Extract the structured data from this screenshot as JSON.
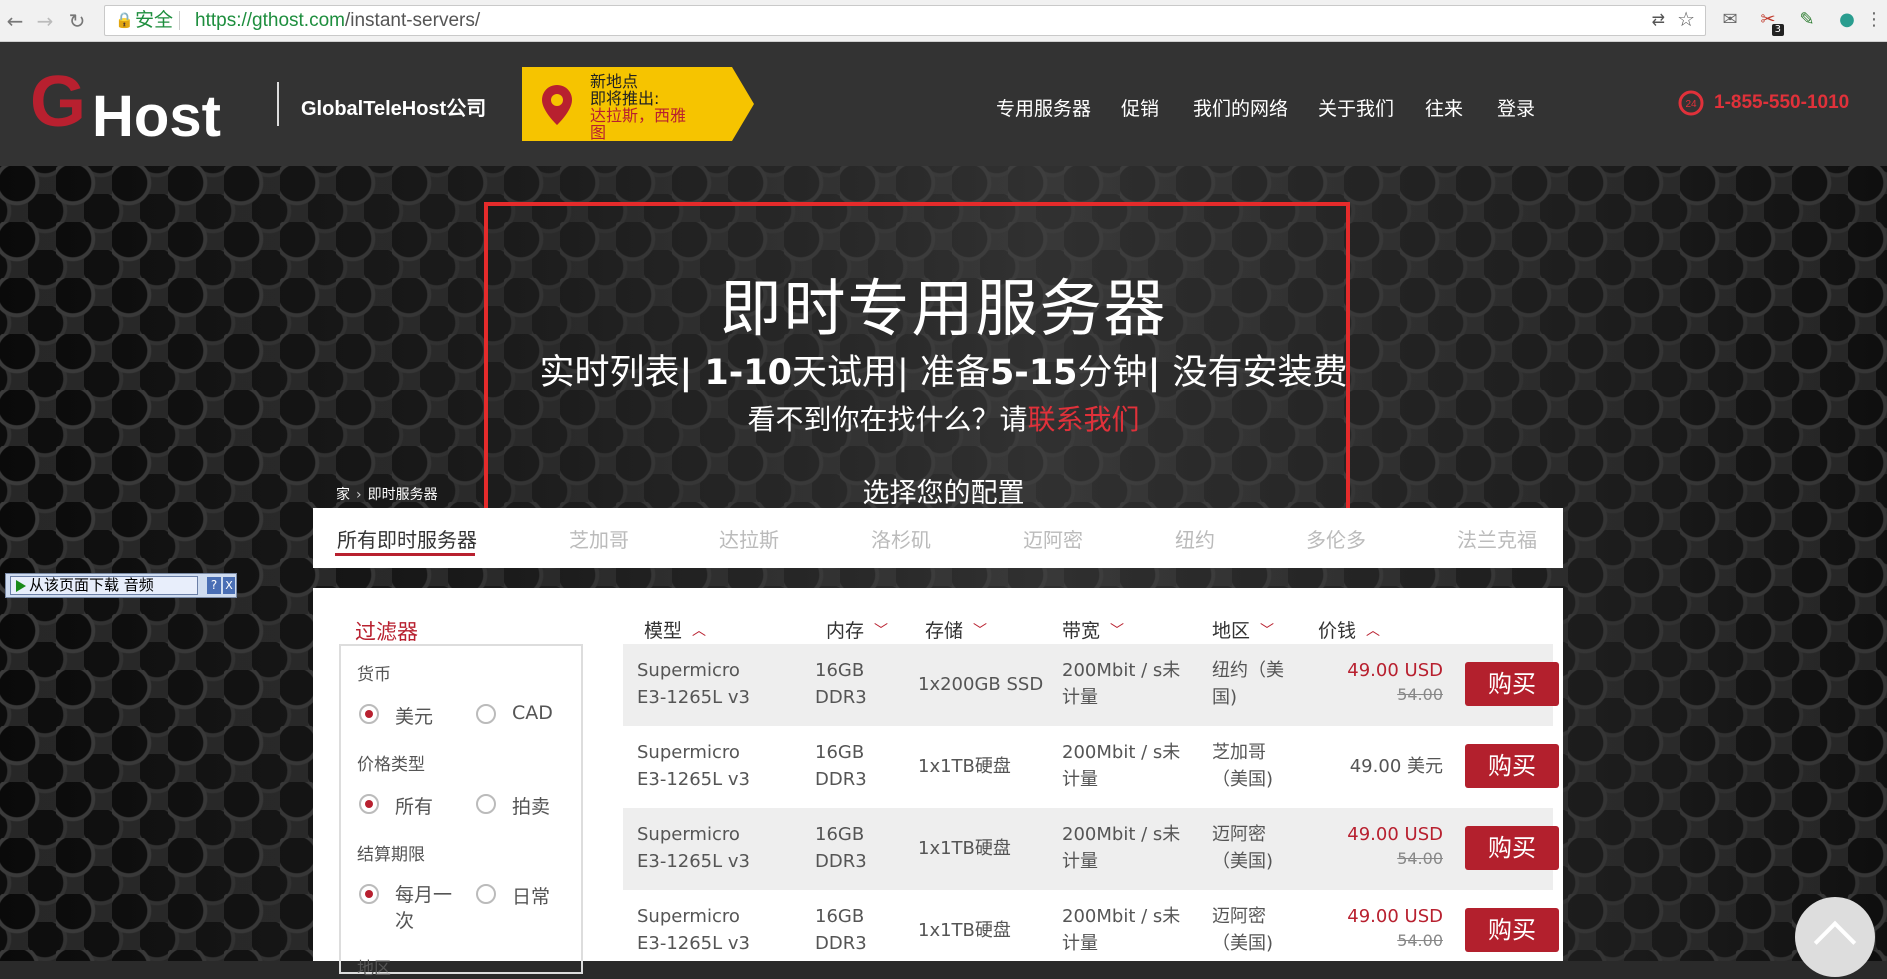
{
  "browser": {
    "secure_label": "安全",
    "url_domain": "https://gthost.com",
    "url_path": "/instant-servers/",
    "extension_badge": "3"
  },
  "header": {
    "logo_letter": "G",
    "logo_text": "Host",
    "company": "GlobalTeleHost公司",
    "promo": {
      "line1": "新地点",
      "line2": "即将推出:",
      "line3": "达拉斯，西雅",
      "line4": "图"
    },
    "nav": [
      "专用服务器",
      "促销",
      "我们的网络",
      "关于我们",
      "往来",
      "登录"
    ],
    "phone": "1-855-550-1010",
    "phone_badge": "24"
  },
  "hero": {
    "title": "即时专用服务器",
    "sub_a": "实时列表",
    "sub_b": "| 1-10",
    "sub_c": "天试用",
    "sub_d": "| 准备",
    "sub_e": "5-15",
    "sub_f": "分钟",
    "sub_g": "| ",
    "sub_h": "没有安装费",
    "line3_text": "看不到你在找什么？请",
    "line3_link": "联系我们",
    "config": "选择您的配置",
    "breadcrumb_home": "家",
    "breadcrumb_sep": "›",
    "breadcrumb_current": "即时服务器"
  },
  "download_bar": {
    "label": "从该页面下载 音频",
    "help": "?",
    "close": "X"
  },
  "tabs": [
    "所有即时服务器",
    "芝加哥",
    "达拉斯",
    "洛杉矶",
    "迈阿密",
    "纽约",
    "多伦多",
    "法兰克福"
  ],
  "filters": {
    "title": "过滤器",
    "currency_label": "货币",
    "currency_options": [
      "美元",
      "CAD"
    ],
    "price_type_label": "价格类型",
    "price_type_options": [
      "所有",
      "拍卖"
    ],
    "billing_label": "结算期限",
    "billing_options": [
      "每月一次",
      "日常"
    ],
    "region_label_partial": "地区"
  },
  "table": {
    "columns": [
      "模型",
      "内存",
      "存储",
      "带宽",
      "地区",
      "价钱"
    ],
    "buy_label": "购买",
    "rows": [
      {
        "model": [
          "Supermicro",
          "E3-1265L v3"
        ],
        "ram": [
          "16GB",
          "DDR3"
        ],
        "storage": "1x200GB SSD",
        "bandwidth": [
          "200Mbit / s未",
          "计量"
        ],
        "region": [
          "纽约（美",
          "国)"
        ],
        "price": "49.00 USD",
        "old_price": "54.00",
        "highlight": true
      },
      {
        "model": [
          "Supermicro",
          "E3-1265L v3"
        ],
        "ram": [
          "16GB",
          "DDR3"
        ],
        "storage": "1x1TB硬盘",
        "bandwidth": [
          "200Mbit / s未",
          "计量"
        ],
        "region": [
          "芝加哥",
          "（美国)"
        ],
        "price": "49.00 美元",
        "old_price": "",
        "highlight": false
      },
      {
        "model": [
          "Supermicro",
          "E3-1265L v3"
        ],
        "ram": [
          "16GB",
          "DDR3"
        ],
        "storage": "1x1TB硬盘",
        "bandwidth": [
          "200Mbit / s未",
          "计量"
        ],
        "region": [
          "迈阿密",
          "（美国)"
        ],
        "price": "49.00 USD",
        "old_price": "54.00",
        "highlight": true
      },
      {
        "model": [
          "Supermicro",
          "E3-1265L v3"
        ],
        "ram": [
          "16GB",
          "DDR3"
        ],
        "storage": "1x1TB硬盘",
        "bandwidth": [
          "200Mbit / s未",
          "计量"
        ],
        "region": [
          "迈阿密",
          "（美国)"
        ],
        "price": "49.00 USD",
        "old_price": "54.00",
        "highlight": true
      }
    ]
  },
  "colors": {
    "accent": "#b8202f",
    "header_bg": "#333333",
    "promo": "#f6c400",
    "highlight_border": "#e52b2b"
  }
}
